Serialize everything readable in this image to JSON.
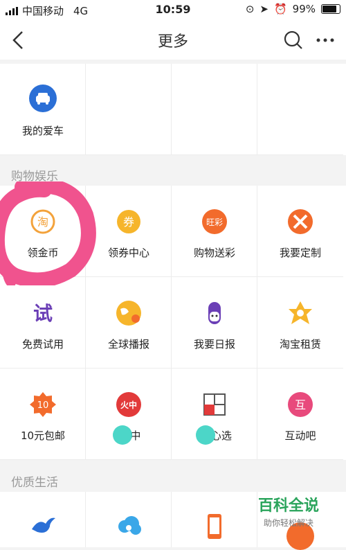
{
  "status": {
    "carrier": "中国移动",
    "network": "4G",
    "time": "10:59",
    "battery": "99%"
  },
  "nav": {
    "title": "更多"
  },
  "top_item": {
    "label": "我的爱车"
  },
  "section1": "购物娱乐",
  "section2": "优质生活",
  "shop_items": [
    {
      "label": "领金币",
      "icon": "coin-icon",
      "color": "#f3a23b"
    },
    {
      "label": "领券中心",
      "icon": "coupon-icon",
      "color": "#f6b52b"
    },
    {
      "label": "购物送彩",
      "icon": "lottery-icon",
      "color": "#f26b2c"
    },
    {
      "label": "我要定制",
      "icon": "customize-icon",
      "color": "#f26b2c"
    },
    {
      "label": "免费试用",
      "icon": "trial-icon",
      "color": "#6b3fb6"
    },
    {
      "label": "全球播报",
      "icon": "globe-icon",
      "color": "#f6b52b"
    },
    {
      "label": "我要日报",
      "icon": "robot-icon",
      "color": "#6b3fb6"
    },
    {
      "label": "淘宝租赁",
      "icon": "lease-icon",
      "color": "#f6b52b"
    },
    {
      "label": "10元包邮",
      "icon": "ten-yuan-icon",
      "color": "#f26b2c"
    },
    {
      "label": "淘  中",
      "icon": "fire-icon",
      "color": "#e23a3a"
    },
    {
      "label": "淘  心选",
      "icon": "select-icon",
      "color": "#555555"
    },
    {
      "label": "互动吧",
      "icon": "interact-icon",
      "color": "#e84a7c"
    }
  ],
  "shop_icon_text": {
    "lottery": "旺彩",
    "ten": "10",
    "fire": "火中",
    "interact": "互",
    "trial": "试",
    "coupon": "券",
    "coin": "淘"
  },
  "watermark": {
    "title": "百科全说",
    "subtitle": "助你轻松解决"
  },
  "colors": {
    "accent_blue": "#2b6fd6",
    "annotation_pink": "#f0538e",
    "highlight_teal": "#4cd6c8"
  }
}
